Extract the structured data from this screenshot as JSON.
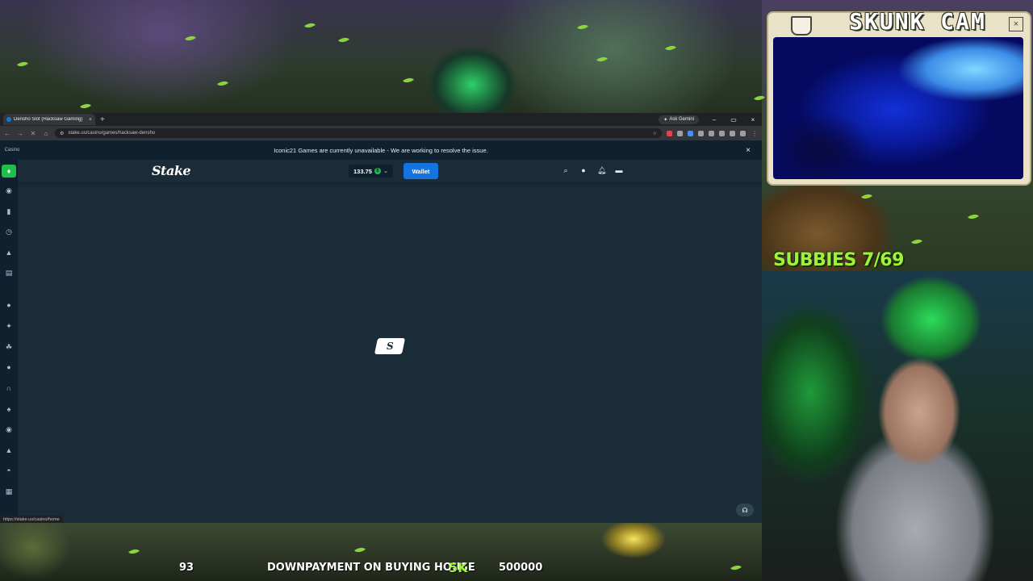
{
  "browser": {
    "tab_title": "Densho Slot (Hacksaw Gaming)",
    "tab_close": "×",
    "new_tab": "+",
    "ask_gemini": "Ask Gemini",
    "window_controls": [
      "–",
      "▭",
      "×"
    ],
    "url": "stake.us/casino/games/hacksaw-densho",
    "status_url": "https://stake.us/casino/home"
  },
  "site": {
    "notice_tag": "Casino",
    "notice": "Iconic21 Games are currently unavailable - We are working to resolve the issue.",
    "notice_close": "×",
    "logo": "Stake",
    "balance": "133.75",
    "coin_symbol": "$",
    "wallet_label": "Wallet",
    "loader_glyph": "S",
    "sidebar_icons": [
      "casino-icon",
      "sports-icon",
      "favourites-icon",
      "recent-icon",
      "challenges-icon",
      "my-bets-icon",
      "originals-icon",
      "exclusives-icon",
      "slots-icon",
      "live-casino-icon",
      "game-shows-icon",
      "stake-poker-icon",
      "blackjack-icon",
      "roulette-icon",
      "baccarat-icon",
      "all-games-icon"
    ]
  },
  "overlay": {
    "skunk_cam_title": "SKUNK CAM",
    "skunk_close": "×",
    "subbies": "SUBBIES 7/69",
    "ticker_count": "93",
    "ticker_goal": "DOWNPAYMENT ON BUYING HOUSE",
    "ticker_current": "5K",
    "ticker_target": "500000"
  },
  "colors": {
    "stake_bg": "#1a2c38",
    "stake_dark": "#0f212e",
    "wallet_blue": "#1475e1",
    "stake_green": "#1fbf4c",
    "overlay_green": "#9ff23a"
  }
}
